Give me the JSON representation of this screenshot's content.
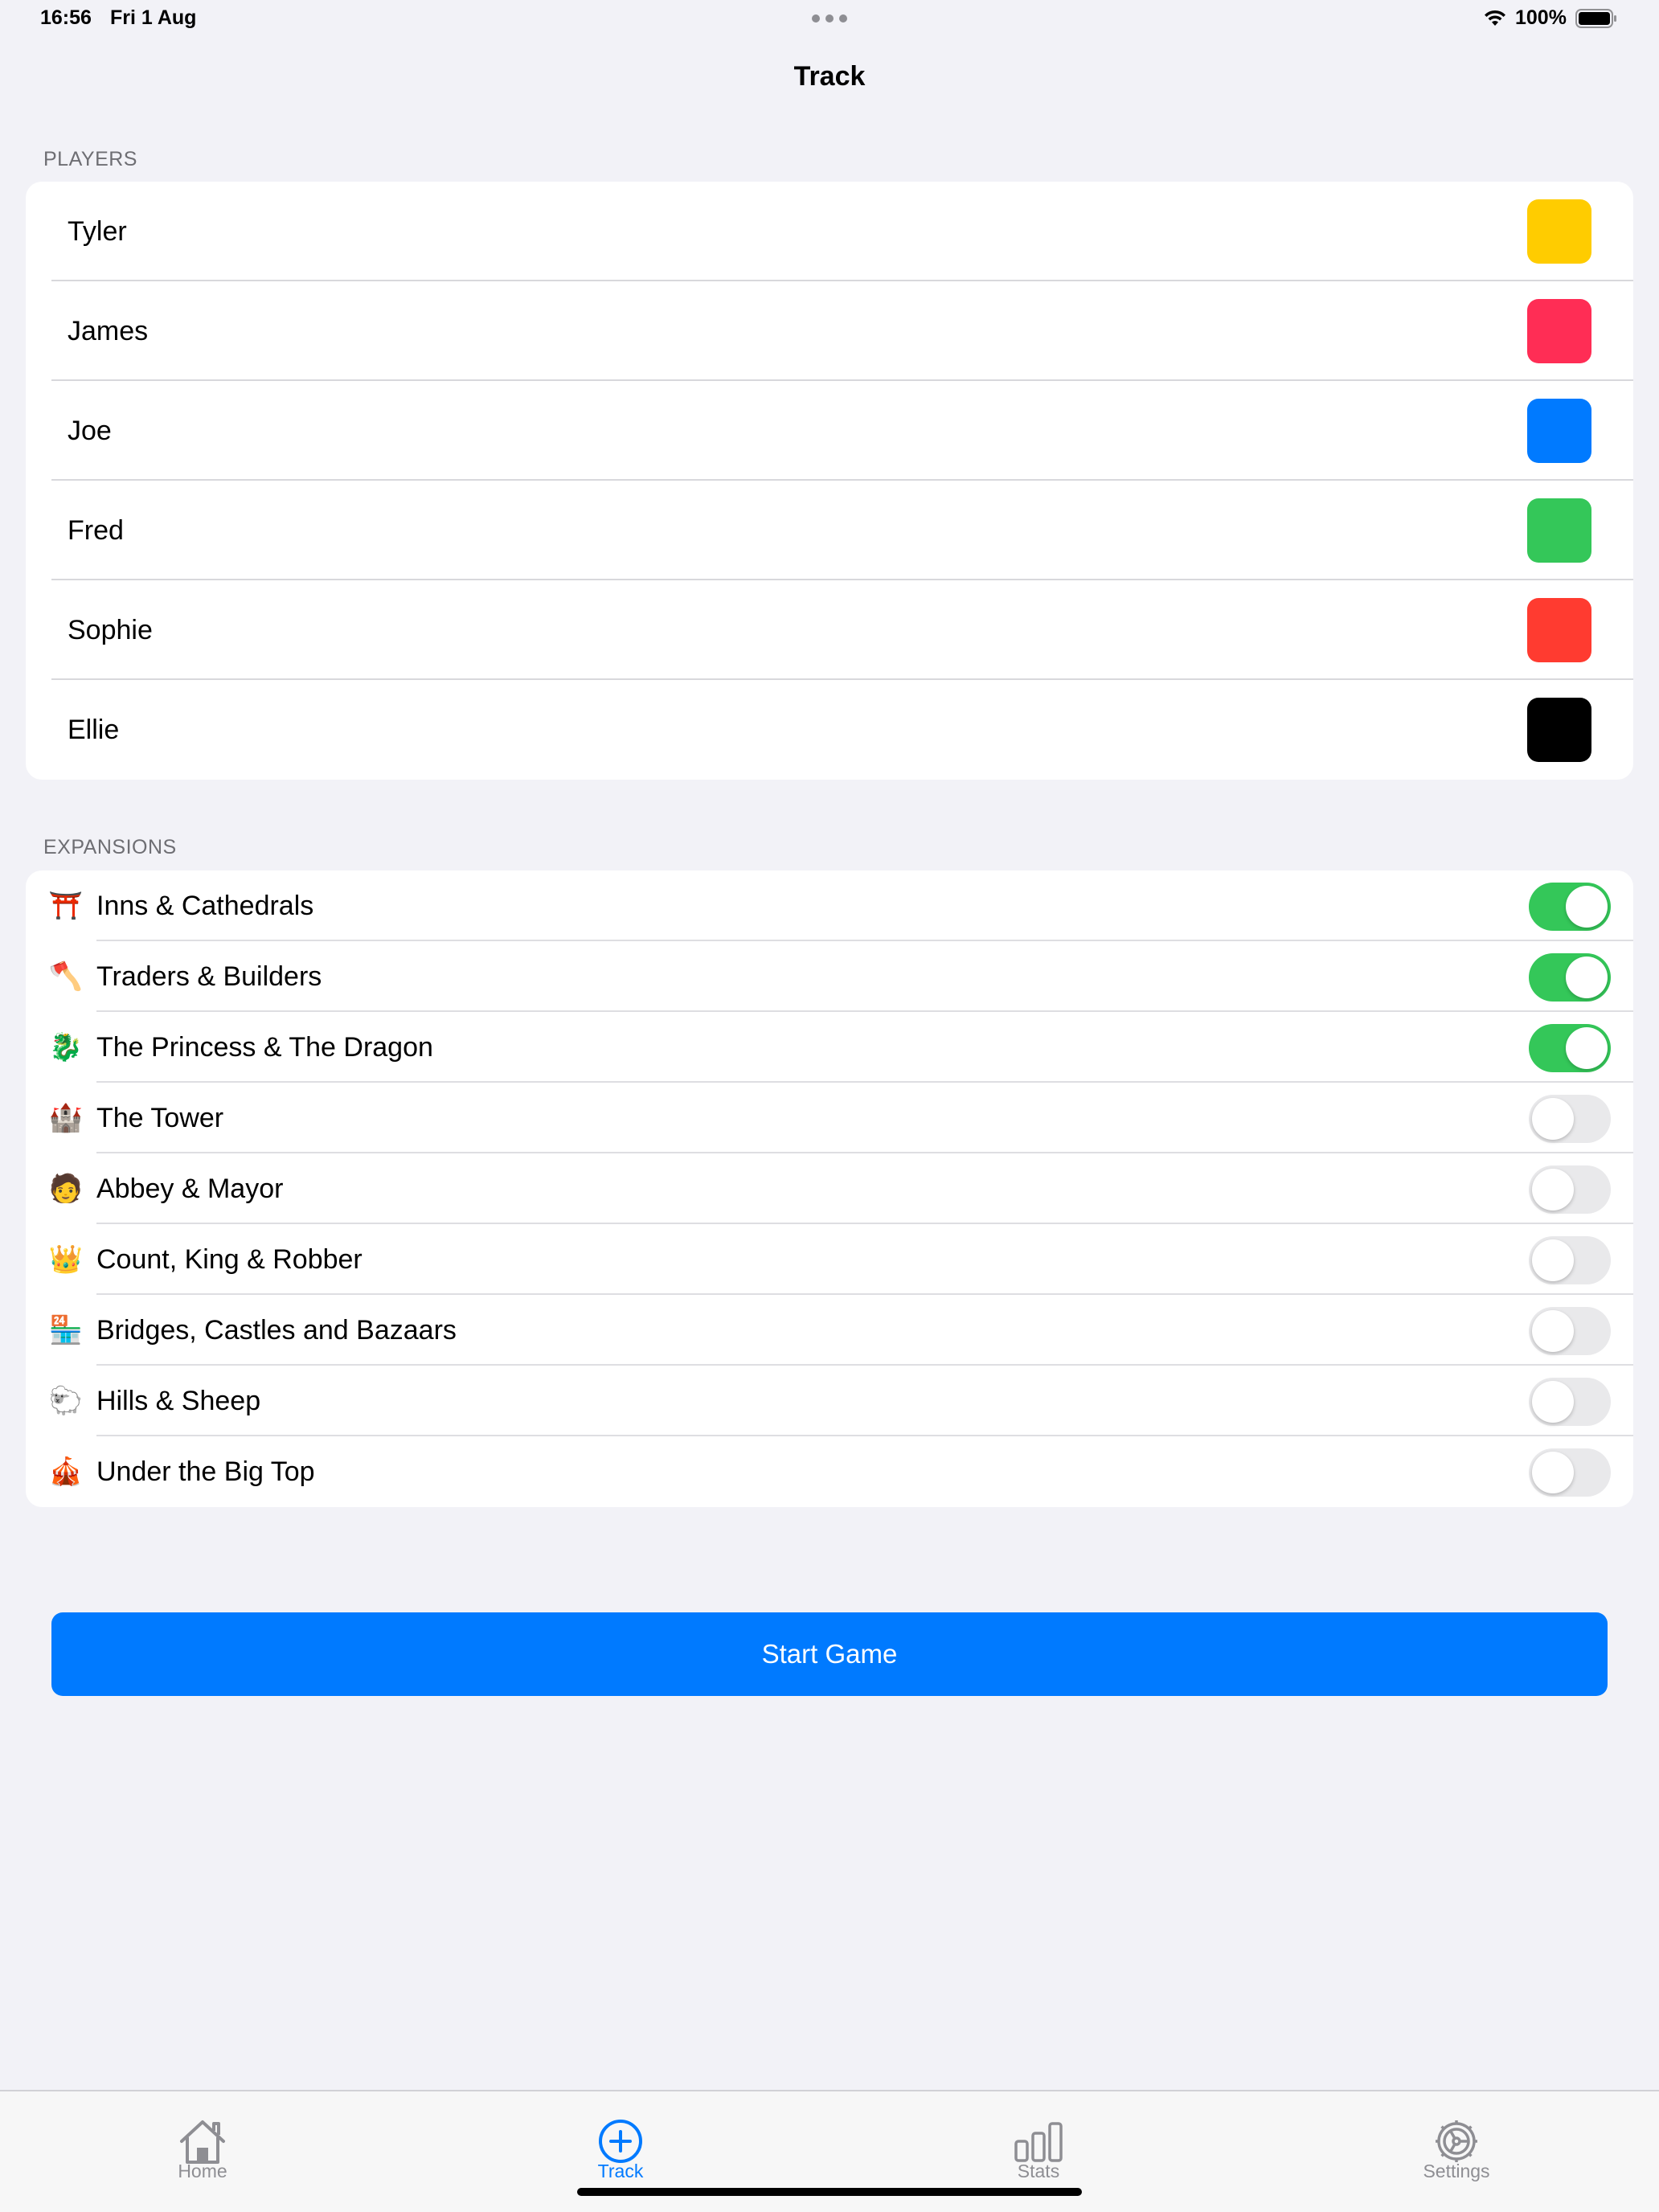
{
  "status_bar": {
    "time": "16:56",
    "date": "Fri 1 Aug",
    "battery": "100%"
  },
  "nav": {
    "title": "Track"
  },
  "players_section": {
    "header": "PLAYERS",
    "players": [
      {
        "name": "Tyler",
        "color": "#ffcc00"
      },
      {
        "name": "James",
        "color": "#ff2d55"
      },
      {
        "name": "Joe",
        "color": "#007aff"
      },
      {
        "name": "Fred",
        "color": "#34c759"
      },
      {
        "name": "Sophie",
        "color": "#ff3b30"
      },
      {
        "name": "Ellie",
        "color": "#000000"
      }
    ]
  },
  "expansions_section": {
    "header": "EXPANSIONS",
    "items": [
      {
        "icon": "⛩️",
        "label": "Inns & Cathedrals",
        "enabled": true
      },
      {
        "icon": "🪓",
        "label": "Traders & Builders",
        "enabled": true
      },
      {
        "icon": "🐉",
        "label": "The Princess & The Dragon",
        "enabled": true
      },
      {
        "icon": "🏰",
        "label": "The Tower",
        "enabled": false
      },
      {
        "icon": "🧑",
        "label": "Abbey & Mayor",
        "enabled": false
      },
      {
        "icon": "👑",
        "label": "Count, King & Robber",
        "enabled": false
      },
      {
        "icon": "🏪",
        "label": "Bridges, Castles and Bazaars",
        "enabled": false
      },
      {
        "icon": "🐑",
        "label": "Hills & Sheep",
        "enabled": false
      },
      {
        "icon": "🎪",
        "label": "Under the Big Top",
        "enabled": false
      }
    ]
  },
  "start_button": {
    "label": "Start Game"
  },
  "tab_bar": {
    "tabs": [
      {
        "label": "Home",
        "icon": "house-icon"
      },
      {
        "label": "Track",
        "icon": "plus-circle-icon",
        "active": true
      },
      {
        "label": "Stats",
        "icon": "bar-chart-icon"
      },
      {
        "label": "Settings",
        "icon": "gear-icon"
      }
    ]
  },
  "colors": {
    "accent": "#007aff",
    "toggle_on": "#34c759",
    "background": "#f2f2f7"
  }
}
